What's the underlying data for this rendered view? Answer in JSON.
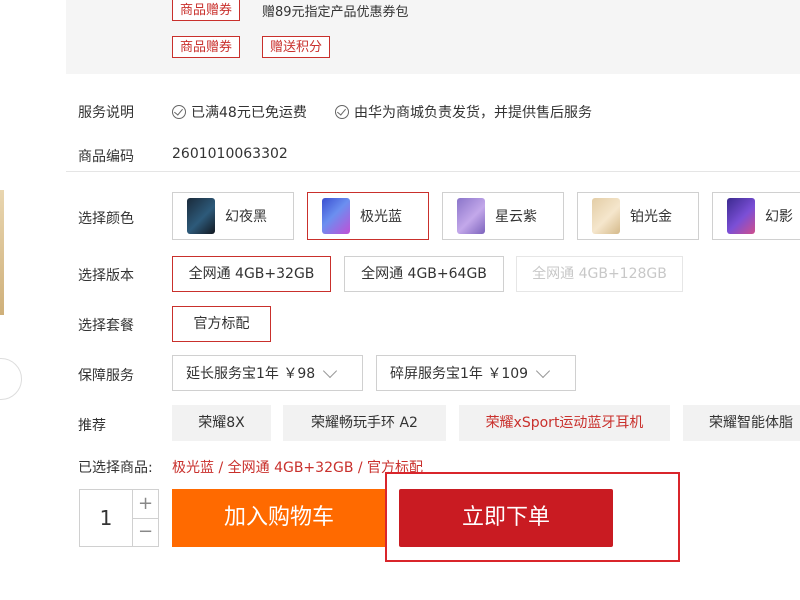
{
  "promo": {
    "coupon_tag": "商品赠券",
    "coupon_text": "赠89元指定产品优惠券包",
    "coupon_tag2": "商品赠券",
    "points_tag": "赠送积分"
  },
  "service": {
    "label": "服务说明",
    "items": [
      "已满48元已免运费",
      "由华为商城负责发货，并提供售后服务"
    ]
  },
  "product_code": {
    "label": "商品编码",
    "value": "2601010063302"
  },
  "color": {
    "label": "选择颜色",
    "options": [
      "幻夜黑",
      "极光蓝",
      "星云紫",
      "铂光金",
      "幻影"
    ],
    "selected": "极光蓝"
  },
  "version": {
    "label": "选择版本",
    "options": [
      "全网通 4GB+32GB",
      "全网通 4GB+64GB",
      "全网通 4GB+128GB"
    ],
    "selected": "全网通 4GB+32GB",
    "disabled": "全网通 4GB+128GB"
  },
  "package": {
    "label": "选择套餐",
    "options": [
      "官方标配"
    ],
    "selected": "官方标配"
  },
  "warranty": {
    "label": "保障服务",
    "dropdowns": [
      "延长服务宝1年 ￥98",
      "碎屏服务宝1年 ￥109"
    ]
  },
  "recommend": {
    "label": "推荐",
    "items": [
      "荣耀8X",
      "荣耀畅玩手环 A2",
      "荣耀xSport运动蓝牙耳机",
      "荣耀智能体脂"
    ]
  },
  "selected_summary": {
    "label": "已选择商品:",
    "value": "极光蓝 / 全网通 4GB+32GB / 官方标配"
  },
  "quantity": {
    "value": "1",
    "plus": "+",
    "minus": "−"
  },
  "actions": {
    "add_to_cart": "加入购物车",
    "buy_now": "立即下单"
  },
  "colors": {
    "accent": "#c9302c",
    "cart": "#ff6a00",
    "buy": "#c91b22"
  }
}
